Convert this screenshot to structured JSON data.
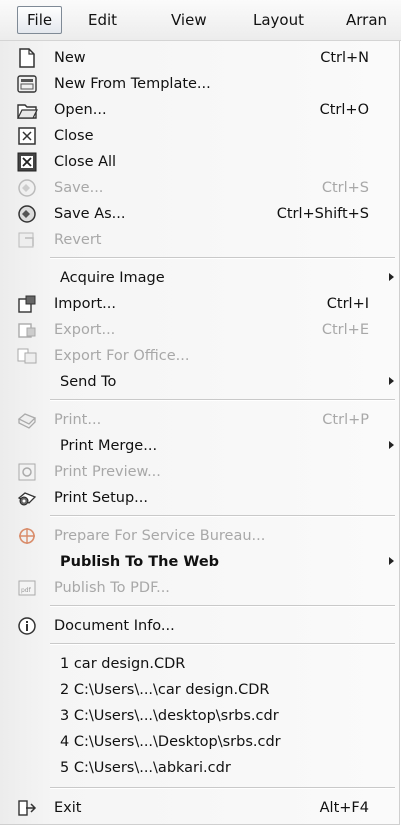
{
  "menubar": {
    "items": [
      "File",
      "Edit",
      "View",
      "Layout",
      "Arran"
    ]
  },
  "menu": {
    "items": [
      {
        "label": "New",
        "shortcut": "Ctrl+N",
        "icon": "new-document-icon"
      },
      {
        "label": "New From Template...",
        "shortcut": "",
        "icon": "template-icon"
      },
      {
        "label": "Open...",
        "shortcut": "Ctrl+O",
        "icon": "open-folder-icon"
      },
      {
        "label": "Close",
        "shortcut": "",
        "icon": "close-document-icon"
      },
      {
        "label": "Close All",
        "shortcut": "",
        "icon": "close-all-icon"
      },
      {
        "label": "Save...",
        "shortcut": "Ctrl+S",
        "icon": "save-icon",
        "disabled": true
      },
      {
        "label": "Save As...",
        "shortcut": "Ctrl+Shift+S",
        "icon": "save-as-icon"
      },
      {
        "label": "Revert",
        "shortcut": "",
        "icon": "revert-icon",
        "disabled": true
      },
      {
        "label": "Acquire Image",
        "shortcut": "",
        "submenu": true
      },
      {
        "label": "Import...",
        "shortcut": "Ctrl+I",
        "icon": "import-icon"
      },
      {
        "label": "Export...",
        "shortcut": "Ctrl+E",
        "icon": "export-icon",
        "disabled": true
      },
      {
        "label": "Export For Office...",
        "shortcut": "",
        "icon": "export-office-icon",
        "disabled": true
      },
      {
        "label": "Send To",
        "shortcut": "",
        "submenu": true
      },
      {
        "label": "Print...",
        "shortcut": "Ctrl+P",
        "icon": "print-icon",
        "disabled": true
      },
      {
        "label": "Print Merge...",
        "shortcut": "",
        "submenu": true
      },
      {
        "label": "Print Preview...",
        "shortcut": "",
        "icon": "print-preview-icon",
        "disabled": true
      },
      {
        "label": "Print Setup...",
        "shortcut": "",
        "icon": "print-setup-icon"
      },
      {
        "label": "Prepare For Service Bureau...",
        "shortcut": "",
        "icon": "service-bureau-icon",
        "disabled": true
      },
      {
        "label": "Publish To The Web",
        "shortcut": "",
        "submenu": true
      },
      {
        "label": "Publish To PDF...",
        "shortcut": "",
        "icon": "publish-pdf-icon",
        "disabled": true
      },
      {
        "label": "Document Info...",
        "shortcut": "",
        "icon": "info-icon"
      },
      {
        "label": "1 car design.CDR",
        "shortcut": ""
      },
      {
        "label": "2 C:\\Users\\...\\car design.CDR",
        "shortcut": ""
      },
      {
        "label": "3 C:\\Users\\...\\desktop\\srbs.cdr",
        "shortcut": ""
      },
      {
        "label": "4 C:\\Users\\...\\Desktop\\srbs.cdr",
        "shortcut": ""
      },
      {
        "label": "5 C:\\Users\\...\\abkari.cdr",
        "shortcut": ""
      },
      {
        "label": "Exit",
        "shortcut": "Alt+F4",
        "icon": "exit-icon"
      }
    ]
  }
}
